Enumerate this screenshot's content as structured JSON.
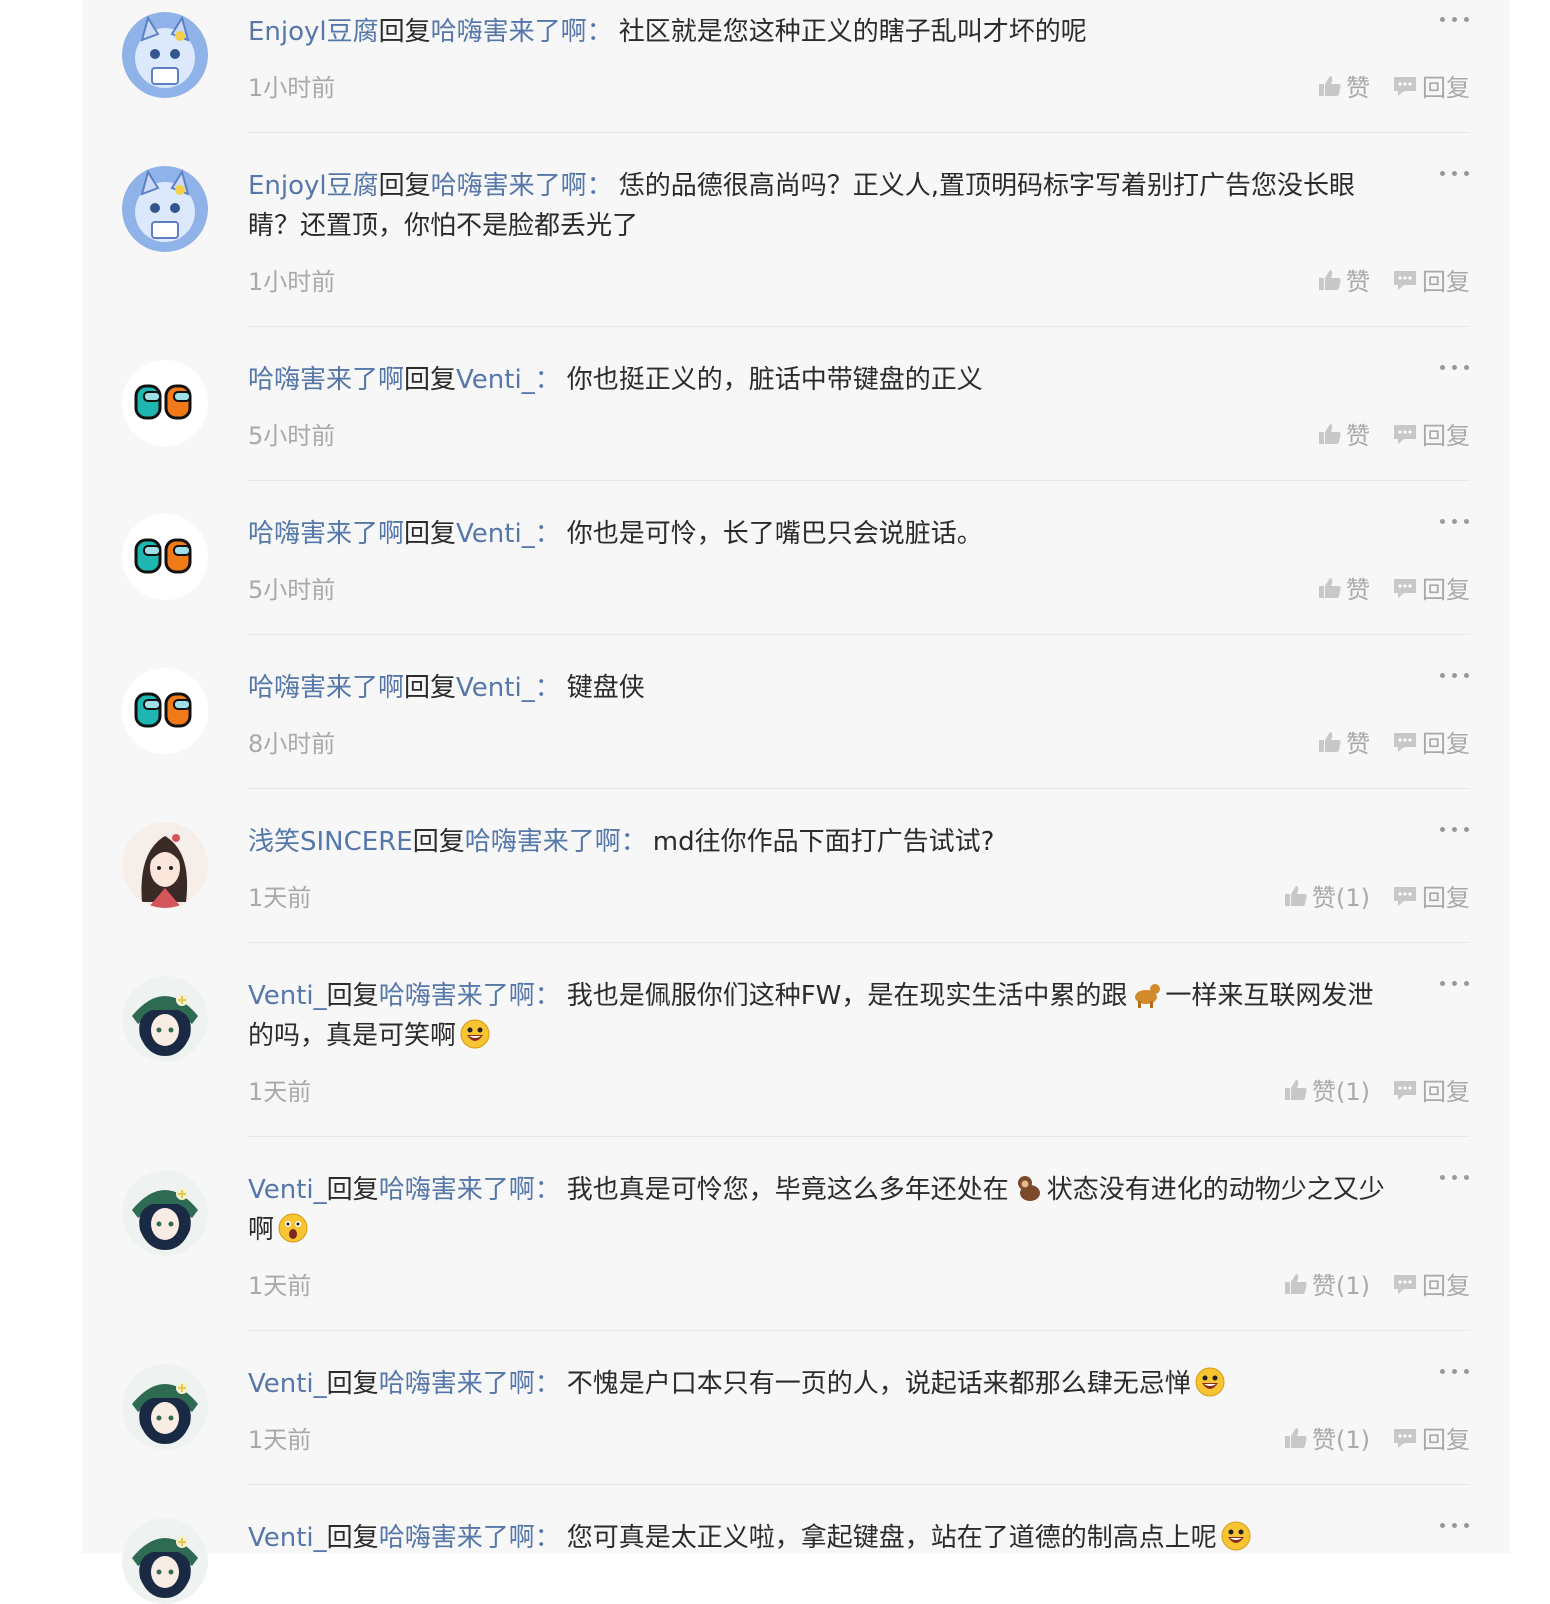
{
  "colors": {
    "username": "#5577aa",
    "text": "#2b2b2b",
    "muted": "#a9a9a9",
    "panel_bg": "#f7f7f7"
  },
  "labels": {
    "reply_word": "回复",
    "colon": "：",
    "like": "赞",
    "reply_action": "回复"
  },
  "comments": [
    {
      "avatar_icon": "cat-avatar-icon",
      "author": "Enjoyl豆腐",
      "target": "哈嗨害来了啊",
      "text": "社区就是您这种正义的瞎子乱叫才坏的呢",
      "time": "1小时前",
      "like_label": "赞"
    },
    {
      "avatar_icon": "cat-avatar-icon",
      "author": "Enjoyl豆腐",
      "target": "哈嗨害来了啊",
      "text": "恁的品德很高尚吗？正义人,置顶明码标字写着别打广告您没长眼睛？还置顶，你怕不是脸都丢光了",
      "time": "1小时前",
      "like_label": "赞"
    },
    {
      "avatar_icon": "among-us-avatar-icon",
      "author": "哈嗨害来了啊",
      "target": "Venti_",
      "text": "你也挺正义的，脏话中带键盘的正义",
      "time": "5小时前",
      "like_label": "赞"
    },
    {
      "avatar_icon": "among-us-avatar-icon",
      "author": "哈嗨害来了啊",
      "target": "Venti_",
      "text": "你也是可怜，长了嘴巴只会说脏话。",
      "time": "5小时前",
      "like_label": "赞"
    },
    {
      "avatar_icon": "among-us-avatar-icon",
      "author": "哈嗨害来了啊",
      "target": "Venti_",
      "text": "键盘侠",
      "time": "8小时前",
      "like_label": "赞"
    },
    {
      "avatar_icon": "anime-girl-avatar-icon",
      "author": "浅笑SINCERE",
      "target": "哈嗨害来了啊",
      "text": "md往你作品下面打广告试试?",
      "time": "1天前",
      "like_label": "赞(1)"
    },
    {
      "avatar_icon": "venti-avatar-icon",
      "author": "Venti_",
      "target": "哈嗨害来了啊",
      "text_parts": [
        "我也是佩服你们这种FW，是在现实生活中累的跟",
        "一样来互联网发泄的吗，真是可笑啊"
      ],
      "emojis": [
        "dog-emoji",
        "grin-emoji"
      ],
      "time": "1天前",
      "like_label": "赞(1)"
    },
    {
      "avatar_icon": "venti-avatar-icon",
      "author": "Venti_",
      "target": "哈嗨害来了啊",
      "text_parts": [
        "我也真是可怜您，毕竟这么多年还处在",
        "状态没有进化的动物少之又少啊"
      ],
      "emojis": [
        "monkey-emoji",
        "shocked-emoji"
      ],
      "time": "1天前",
      "like_label": "赞(1)"
    },
    {
      "avatar_icon": "venti-avatar-icon",
      "author": "Venti_",
      "target": "哈嗨害来了啊",
      "text": "不愧是户口本只有一页的人，说起话来都那么肆无忌惮",
      "emojis": [
        "grin-emoji"
      ],
      "time": "1天前",
      "like_label": "赞(1)"
    },
    {
      "avatar_icon": "venti-avatar-icon",
      "author": "Venti_",
      "target": "哈嗨害来了啊",
      "text": "您可真是太正义啦，拿起键盘，站在了道德的制高点上呢",
      "emojis": [
        "grin-emoji"
      ]
    }
  ]
}
